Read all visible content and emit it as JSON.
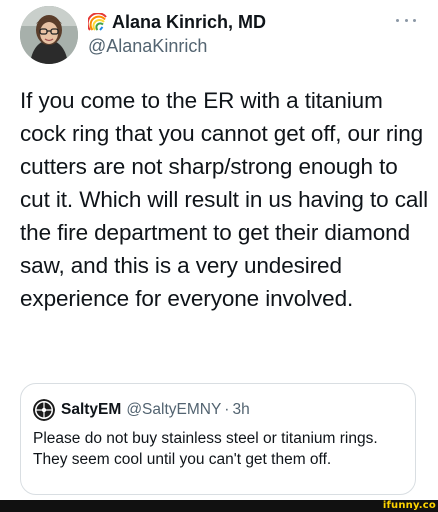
{
  "tweet": {
    "author": {
      "display_name": "Alana Kinrich, MD",
      "handle": "@AlanaKinrich",
      "name_icon": "rainbow-icon",
      "avatar_icon": "profile-photo"
    },
    "text": "If you come to the ER with a titanium cock ring that you cannot get off, our ring cutters are not sharp/strong enough to cut it. Which will result in us having to call the fire department to get their diamond saw, and this is a very undesired experience for everyone involved.",
    "more_icon": "more-options-icon"
  },
  "quoted_tweet": {
    "display_name": "SaltyEM",
    "handle": "@SaltyEMNY",
    "separator": "·",
    "time": "3h",
    "text": "Please do not buy stainless steel or titanium rings. They seem cool until you can't get them off."
  },
  "watermark": {
    "text": "ifunny.co"
  },
  "colors": {
    "text_primary": "#0f1419",
    "text_secondary": "#536471",
    "border": "#d9dee2",
    "watermark": "#ffd400",
    "watermark_bar": "#111111"
  }
}
